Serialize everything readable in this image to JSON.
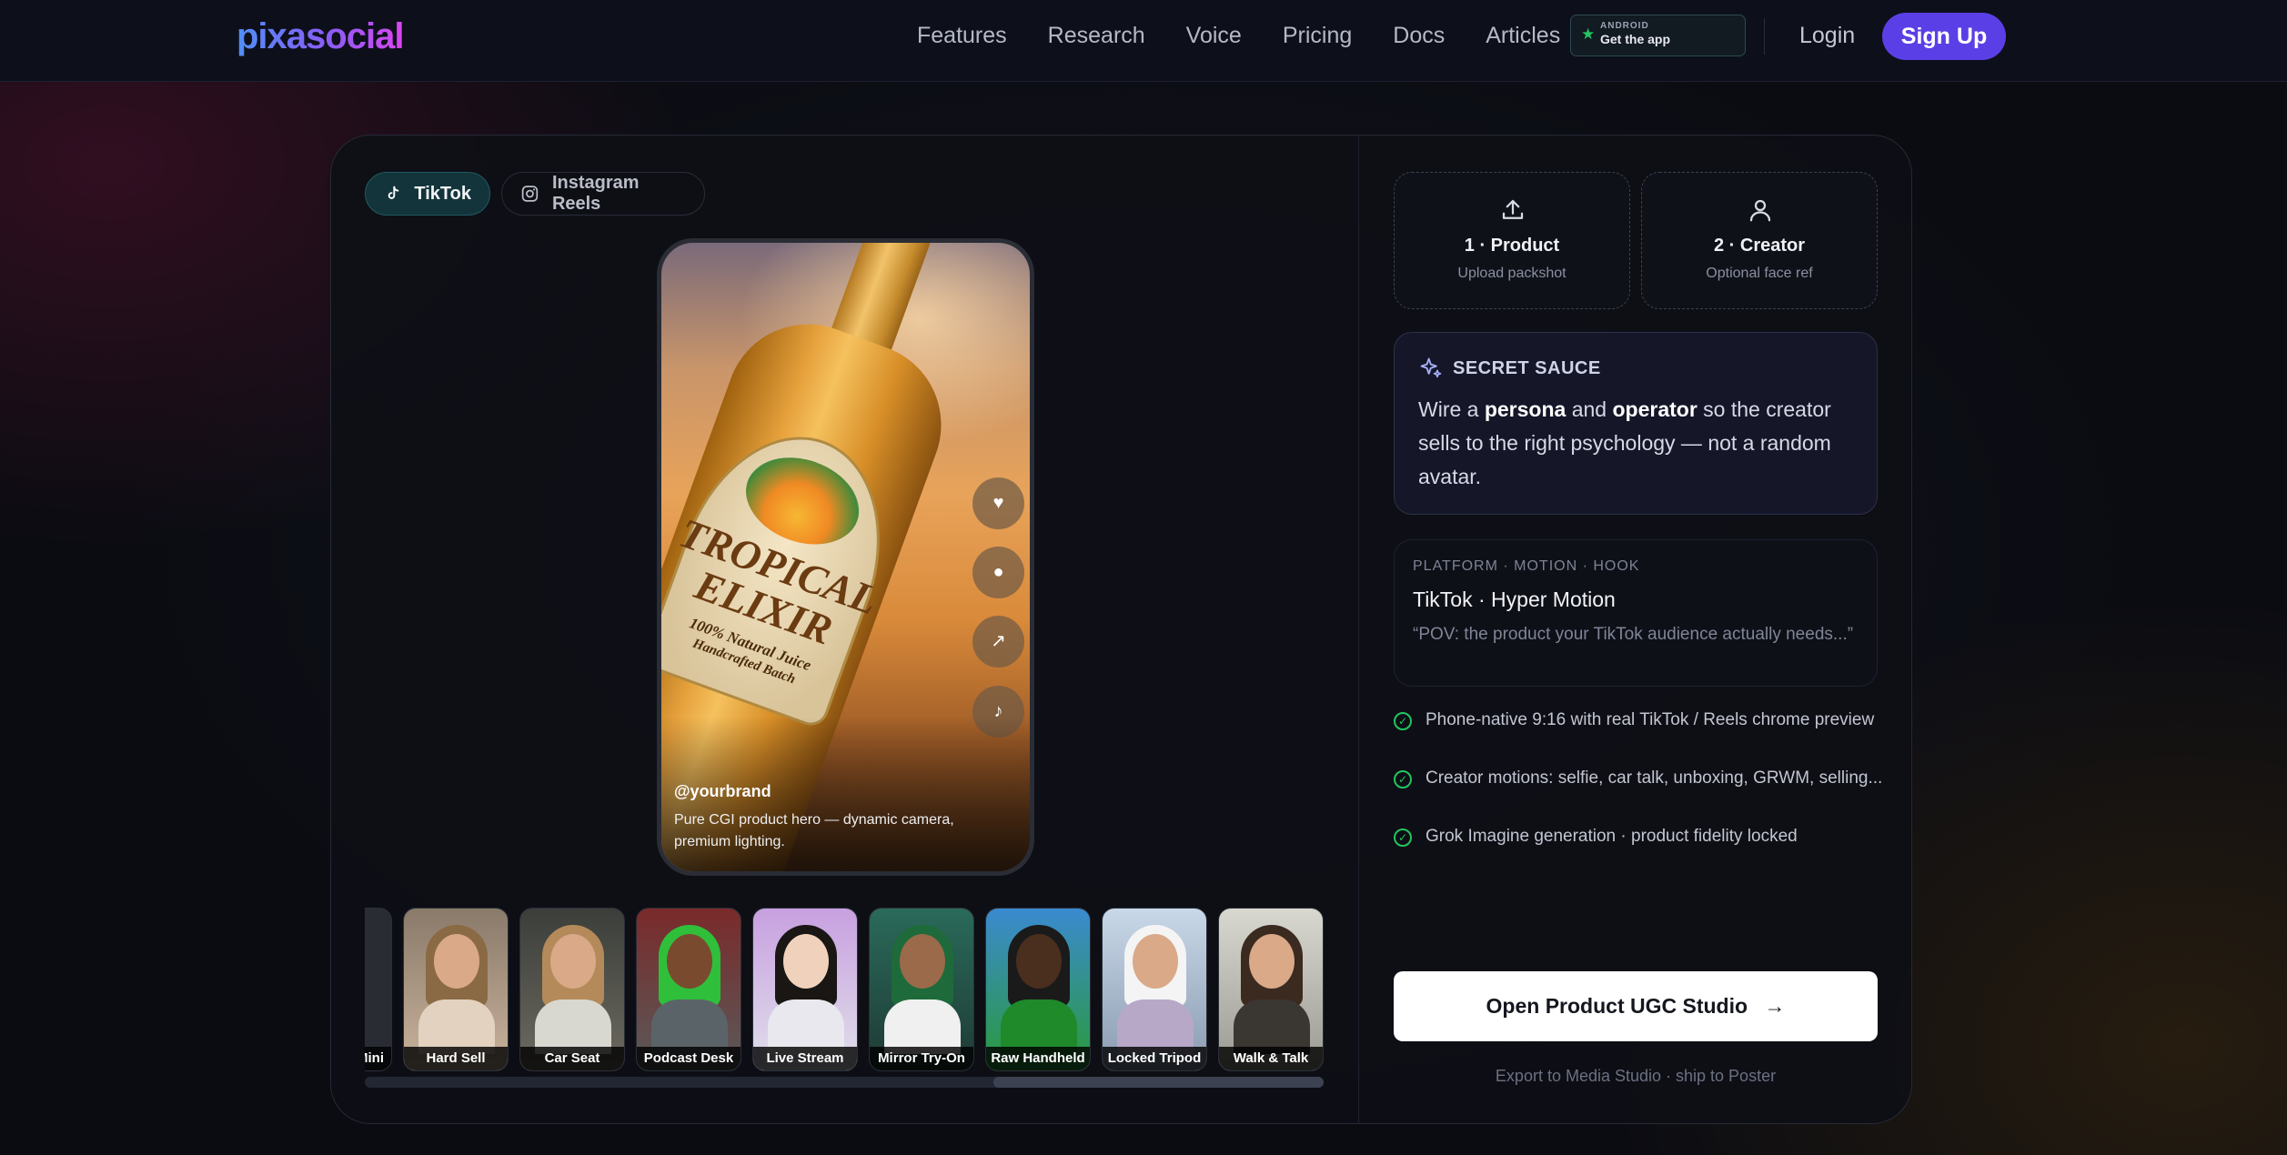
{
  "nav": {
    "logo": "pixasocial",
    "links": [
      "Features",
      "Research",
      "Voice",
      "Pricing",
      "Docs",
      "Articles"
    ],
    "android_small": "ANDROID",
    "android_big": "Get the app",
    "login": "Login",
    "signup": "Sign Up"
  },
  "platform_tabs": [
    {
      "label": "TikTok",
      "icon": "tiktok-icon",
      "active": true
    },
    {
      "label": "Instagram Reels",
      "icon": "instagram-icon",
      "active": false
    }
  ],
  "phone": {
    "brand_line1": "TROPICAL",
    "brand_line2": "ELIXIR",
    "brand_line3": "100% Natural Juice",
    "brand_line4": "Handcrafted Batch",
    "handle": "@yourbrand",
    "caption": "Pure CGI product hero — dynamic camera, premium lighting.",
    "side_buttons": [
      "heart-icon",
      "comment-icon",
      "share-icon",
      "music-icon"
    ]
  },
  "thumbnails": [
    {
      "label": "Mini"
    },
    {
      "label": "Hard Sell"
    },
    {
      "label": "Car Seat"
    },
    {
      "label": "Podcast Desk"
    },
    {
      "label": "Live Stream"
    },
    {
      "label": "Mirror Try-On"
    },
    {
      "label": "Raw Handheld"
    },
    {
      "label": "Locked Tripod"
    },
    {
      "label": "Walk & Talk"
    }
  ],
  "scroll_position": 0.66,
  "uploads": [
    {
      "title": "1 · Product",
      "sub": "Upload packshot",
      "icon": "upload-icon"
    },
    {
      "title": "2 · Creator",
      "sub": "Optional face ref",
      "icon": "user-icon"
    }
  ],
  "sauce": {
    "title": "SECRET SAUCE",
    "pre": "Wire a ",
    "bold1": "persona",
    "mid": " and ",
    "bold2": "operator",
    "post": " so the creator sells to the right psychology — not a random avatar."
  },
  "hook": {
    "kicker": "PLATFORM · MOTION · HOOK",
    "title": "TikTok · Hyper Motion",
    "quote": "“POV: the product your TikTok audience actually needs...”"
  },
  "features": [
    "Phone-native 9:16 with real TikTok / Reels chrome preview",
    "Creator motions: selfie, car talk, unboxing, GRWM, selling...",
    "Grok Imagine generation · product fidelity locked"
  ],
  "open_button": "Open Product UGC Studio",
  "export_text": "Export to Media Studio · ship to Poster",
  "colors": {
    "accent": "#5b3fe6",
    "tiktok_tab": "#13343a",
    "check": "#22c55e"
  }
}
